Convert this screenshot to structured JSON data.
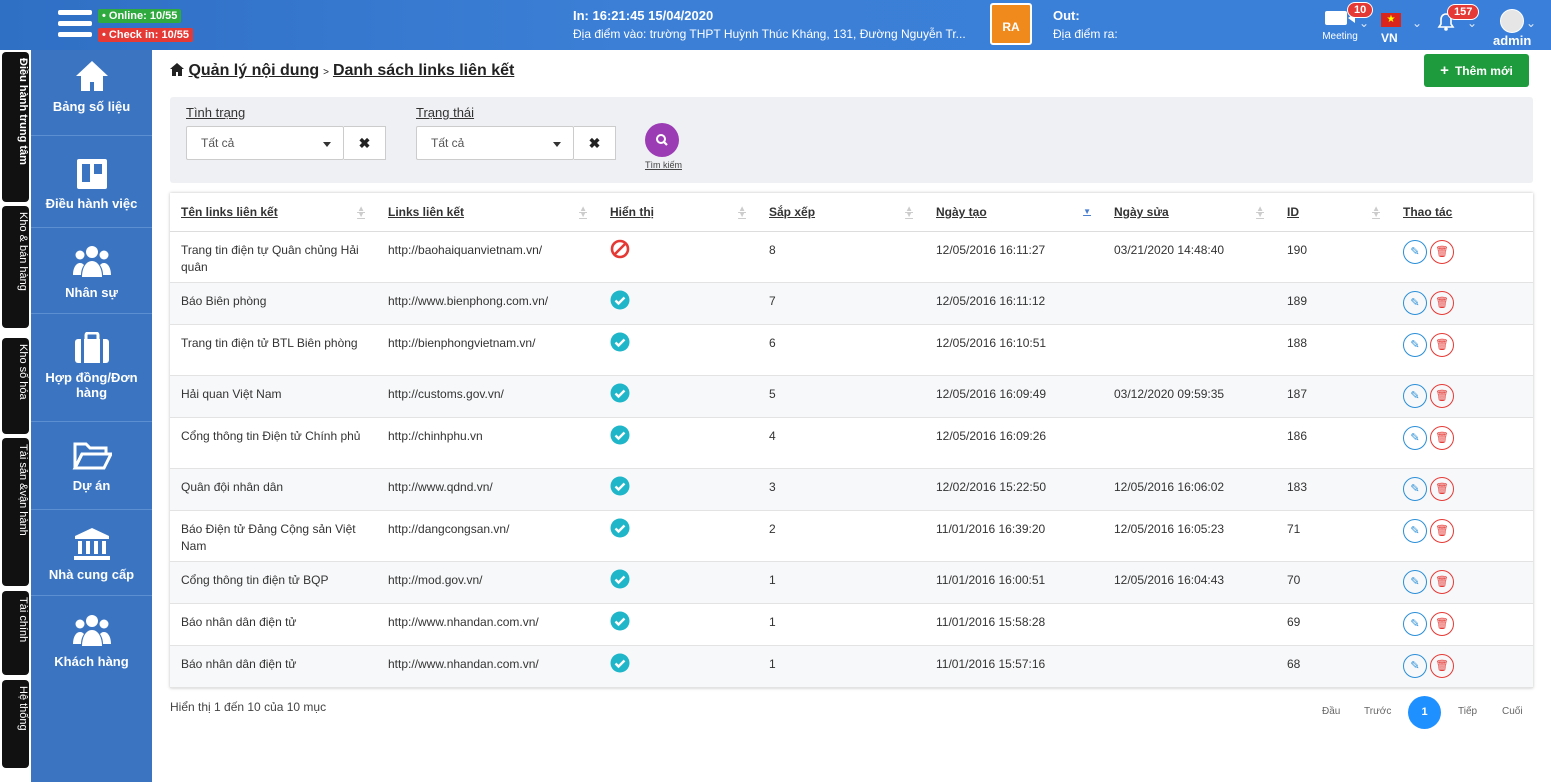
{
  "header": {
    "online": "• Online: 10/55",
    "checkin": "• Check in: 10/55",
    "in_time": "In: 16:21:45 15/04/2020",
    "in_place": "Địa điểm vào: trường THPT Huỳnh Thúc Kháng, 131, Đường Nguyễn Tr...",
    "logo_text": "RA",
    "out_label": "Out:",
    "out_place": "Địa điểm ra:",
    "meeting_label": "Meeting",
    "meeting_count": "10",
    "lang": "VN",
    "notif_count": "157",
    "user": "admin"
  },
  "vtabs": [
    "Điều hành trung tâm",
    "Kho & bán hàng",
    "Kho số hóa",
    "Tài sản &vận hành",
    "Tài chính",
    "Hệ thống"
  ],
  "sidebar": [
    {
      "label": "Bảng số liệu",
      "icon": "home-icon"
    },
    {
      "label": "Điều hành việc",
      "icon": "board-icon"
    },
    {
      "label": "Nhân sự",
      "icon": "users-icon"
    },
    {
      "label": "Hợp đồng/Đơn hàng",
      "icon": "briefcase-icon"
    },
    {
      "label": "Dự án",
      "icon": "folder-icon"
    },
    {
      "label": "Nhà cung cấp",
      "icon": "bank-icon"
    },
    {
      "label": "Khách hàng",
      "icon": "customers-icon"
    }
  ],
  "breadcrumb": {
    "root": "Quản lý nội dung",
    "sep": ">",
    "current": "Danh sách links liên kết"
  },
  "add_button": "Thêm mới",
  "filters": {
    "tinh_trang_label": "Tình trạng",
    "tinh_trang_value": "Tất cả",
    "trang_thai_label": "Trạng thái",
    "trang_thai_value": "Tất cả",
    "search_label": "Tìm kiếm"
  },
  "table": {
    "columns": [
      "Tên links liên kết",
      "Links liên kết",
      "Hiển thị",
      "Sắp xếp",
      "Ngày tạo",
      "Ngày sửa",
      "ID",
      "Thao tác"
    ],
    "rows": [
      {
        "name": "Trang tin điện tự Quân chủng Hải quân",
        "link": "http://baohaiquanvietnam.vn/",
        "visible": false,
        "order": "8",
        "created": "12/05/2016 16:11:27",
        "updated": "03/21/2020 14:48:40",
        "id": "190"
      },
      {
        "name": "Báo Biên phòng",
        "link": "http://www.bienphong.com.vn/",
        "visible": true,
        "order": "7",
        "created": "12/05/2016 16:11:12",
        "updated": "",
        "id": "189"
      },
      {
        "name": "Trang tin điện tử BTL Biên phòng",
        "link": "http://bienphongvietnam.vn/",
        "visible": true,
        "order": "6",
        "created": "12/05/2016 16:10:51",
        "updated": "",
        "id": "188"
      },
      {
        "name": "Hải quan Việt Nam",
        "link": "http://customs.gov.vn/",
        "visible": true,
        "order": "5",
        "created": "12/05/2016 16:09:49",
        "updated": "03/12/2020 09:59:35",
        "id": "187"
      },
      {
        "name": "Cổng thông tin Điện tử Chính phủ",
        "link": "http://chinhphu.vn",
        "visible": true,
        "order": "4",
        "created": "12/05/2016 16:09:26",
        "updated": "",
        "id": "186"
      },
      {
        "name": "Quân đội nhân dân",
        "link": "http://www.qdnd.vn/",
        "visible": true,
        "order": "3",
        "created": "12/02/2016 15:22:50",
        "updated": "12/05/2016 16:06:02",
        "id": "183"
      },
      {
        "name": "Báo Điện tử Đảng Cộng sản Việt Nam",
        "link": "http://dangcongsan.vn/",
        "visible": true,
        "order": "2",
        "created": "11/01/2016 16:39:20",
        "updated": "12/05/2016 16:05:23",
        "id": "71"
      },
      {
        "name": "Cổng thông tin điện tử BQP",
        "link": "http://mod.gov.vn/",
        "visible": true,
        "order": "1",
        "created": "11/01/2016 16:00:51",
        "updated": "12/05/2016 16:04:43",
        "id": "70"
      },
      {
        "name": "Báo nhân dân điện tử",
        "link": "http://www.nhandan.com.vn/",
        "visible": true,
        "order": "1",
        "created": "11/01/2016 15:58:28",
        "updated": "",
        "id": "69"
      },
      {
        "name": "Báo nhân dân điện tử",
        "link": "http://www.nhandan.com.vn/",
        "visible": true,
        "order": "1",
        "created": "11/01/2016 15:57:16",
        "updated": "",
        "id": "68"
      }
    ]
  },
  "footer": {
    "info": "Hiển thị 1 đến 10 của 10 mục",
    "first": "Đầu",
    "prev": "Trước",
    "page": "1",
    "next": "Tiếp",
    "last": "Cuối"
  },
  "colors": {
    "header": "#3a80da",
    "sidebar": "#3b75c2",
    "add": "#1e9b3c",
    "search": "#9c3cb5",
    "check": "#1fb6c9",
    "forbidden": "#e53935"
  }
}
